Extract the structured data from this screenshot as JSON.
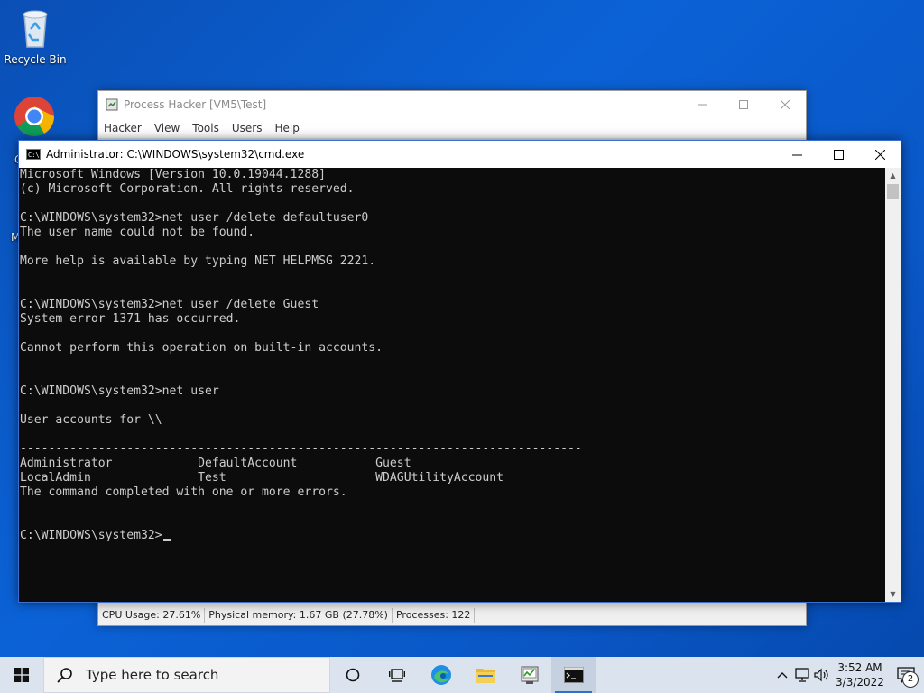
{
  "desktop": {
    "recycle_bin_label": "Recycle Bin",
    "chrome_partial_label": "C",
    "partial_label_m": "M"
  },
  "process_hacker": {
    "title": "Process Hacker [VM5\\Test]",
    "menu": [
      "Hacker",
      "View",
      "Tools",
      "Users",
      "Help"
    ],
    "status": {
      "cpu": "CPU Usage: 27.61%",
      "memory": "Physical memory: 1.67 GB (27.78%)",
      "processes": "Processes: 122"
    }
  },
  "cmd": {
    "title": "Administrator: C:\\WINDOWS\\system32\\cmd.exe",
    "output": "Microsoft Windows [Version 10.0.19044.1288]\n(c) Microsoft Corporation. All rights reserved.\n\nC:\\WINDOWS\\system32>net user /delete defaultuser0\nThe user name could not be found.\n\nMore help is available by typing NET HELPMSG 2221.\n\n\nC:\\WINDOWS\\system32>net user /delete Guest\nSystem error 1371 has occurred.\n\nCannot perform this operation on built-in accounts.\n\n\nC:\\WINDOWS\\system32>net user\n\nUser accounts for \\\\\n\n-------------------------------------------------------------------------------\nAdministrator            DefaultAccount           Guest\nLocalAdmin               Test                     WDAGUtilityAccount\nThe command completed with one or more errors.\n\n\nC:\\WINDOWS\\system32>"
  },
  "taskbar": {
    "search_placeholder": "Type here to search",
    "apps": [
      "task-view",
      "edge",
      "file-explorer",
      "process-hacker",
      "command-prompt"
    ],
    "active_app": "command-prompt",
    "clock_time": "3:52 AM",
    "clock_date": "3/3/2022",
    "notification_count": "2"
  }
}
